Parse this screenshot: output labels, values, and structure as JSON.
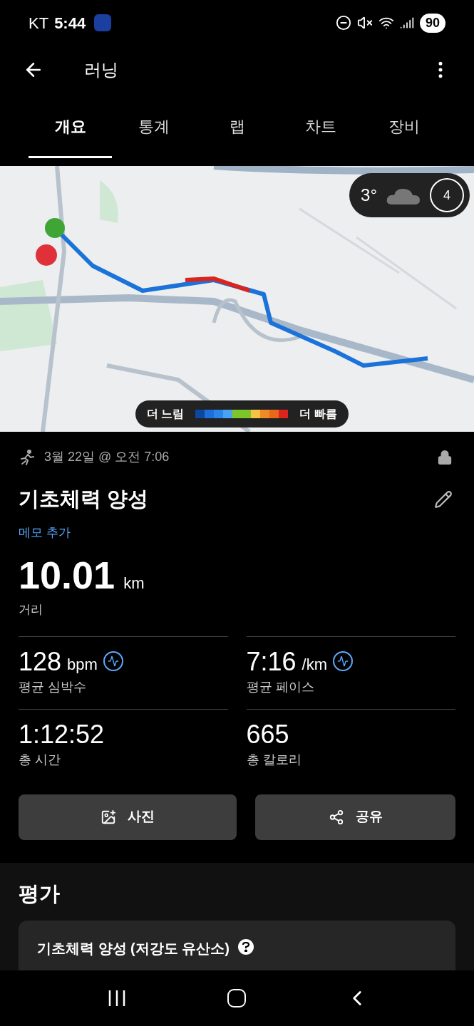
{
  "status_bar": {
    "carrier": "KT",
    "time": "5:44",
    "battery": "90"
  },
  "header": {
    "title": "러닝"
  },
  "tabs": [
    {
      "label": "개요",
      "selected": true
    },
    {
      "label": "통계",
      "selected": false
    },
    {
      "label": "랩",
      "selected": false
    },
    {
      "label": "차트",
      "selected": false
    },
    {
      "label": "장비",
      "selected": false
    }
  ],
  "map": {
    "kind": "picture",
    "weather": {
      "temperature": "3°",
      "wind": "4"
    },
    "legend": {
      "slow_label": "더 느림",
      "fast_label": "더 빠름",
      "segments": [
        {
          "color": "#0d47a1"
        },
        {
          "color": "#1e6fd9"
        },
        {
          "color": "#2a86ea"
        },
        {
          "color": "#4aa3f2"
        },
        {
          "color": "#7cc62a"
        },
        {
          "color": "#7cc62a"
        },
        {
          "color": "#f6c343"
        },
        {
          "color": "#f08a24"
        },
        {
          "color": "#e9671a"
        },
        {
          "color": "#d9251d"
        }
      ]
    }
  },
  "activity": {
    "date": "3월 22일 @ 오전 7:06",
    "title": "기초체력 양성",
    "memo_link": "메모 추가",
    "distance": {
      "value": "10.01",
      "unit": "km",
      "label": "거리"
    },
    "stats": [
      {
        "kind": "graph",
        "value": "128",
        "unit": "bpm",
        "label": "평균 심박수"
      },
      {
        "kind": "graph",
        "value": "7:16",
        "unit": "/km",
        "label": "평균 페이스"
      },
      {
        "kind": "plain",
        "value": "1:12:52",
        "label": "총 시간"
      },
      {
        "kind": "plain",
        "value": "665",
        "label": "총 칼로리"
      }
    ],
    "buttons": [
      {
        "label": "사진"
      },
      {
        "kind": "share",
        "label": "공유"
      }
    ]
  },
  "evaluation": {
    "heading": "평가",
    "card_title": "기초체력 양성 (저강도 유산소)"
  }
}
